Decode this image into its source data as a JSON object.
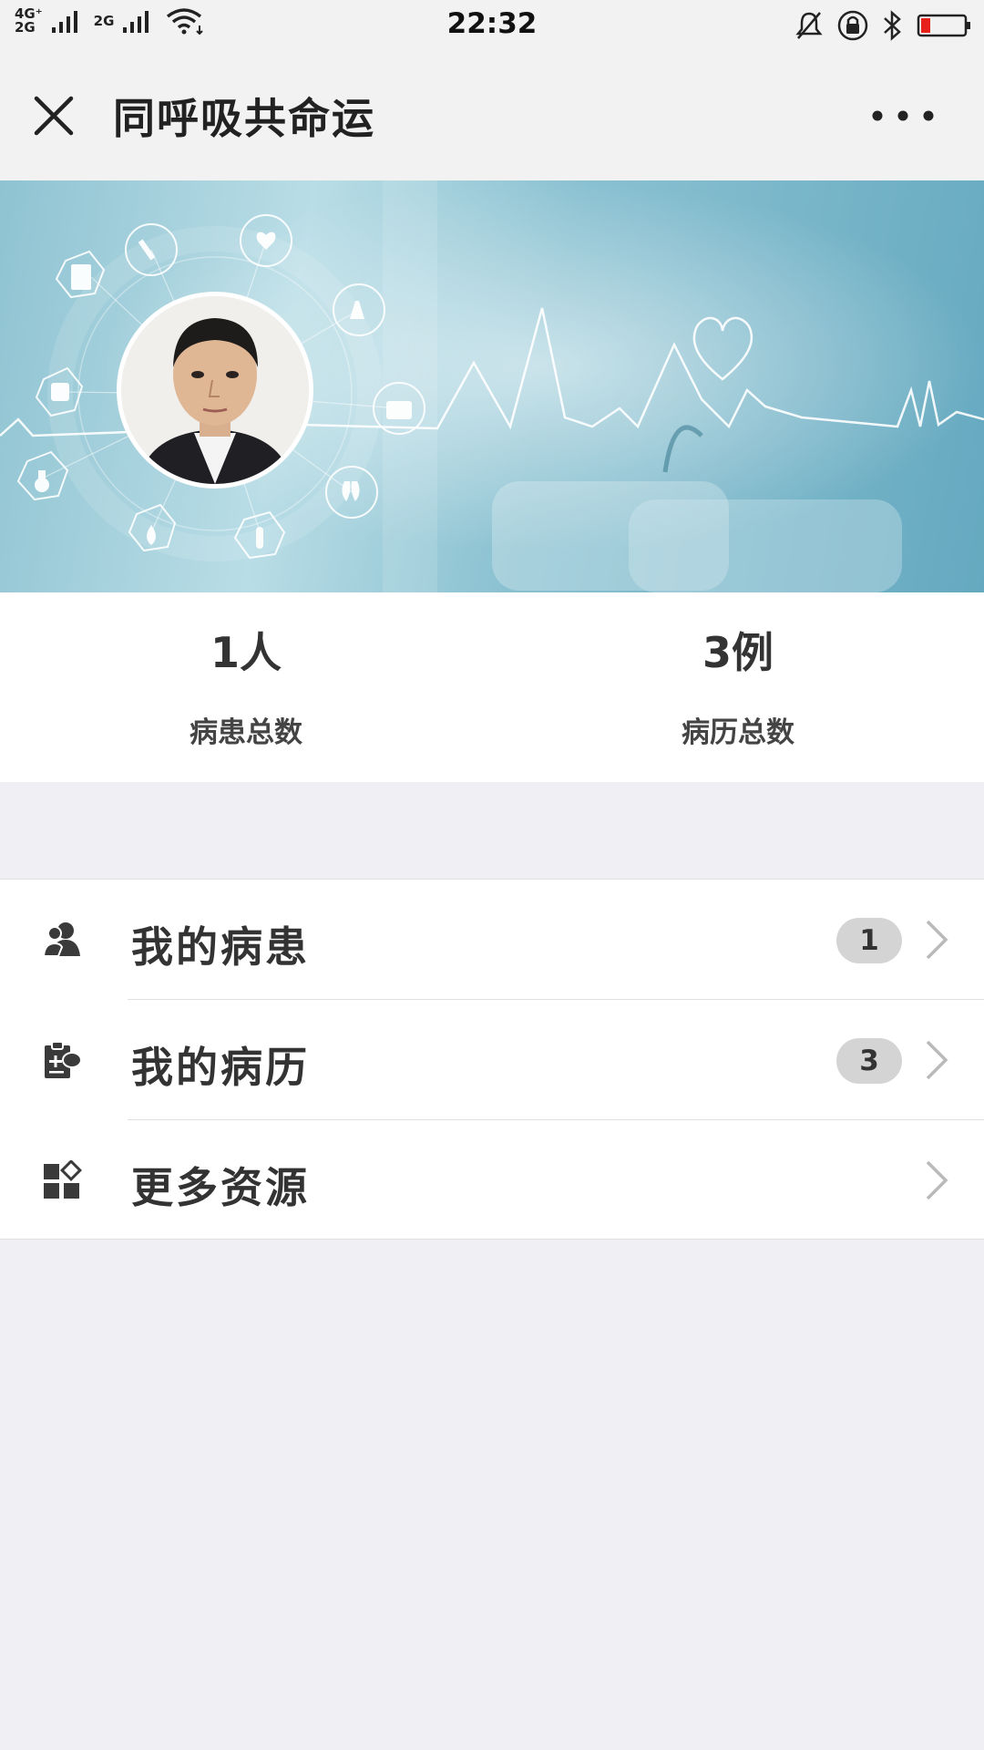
{
  "status_bar": {
    "network_left": "4G⁺\n2G",
    "network_right": "2G",
    "time": "22:32"
  },
  "nav": {
    "title": "同呼吸共命运",
    "close_icon": "close-icon",
    "more_icon": "more-icon"
  },
  "stats": [
    {
      "value": "1人",
      "label": "病患总数"
    },
    {
      "value": "3例",
      "label": "病历总数"
    }
  ],
  "menu": [
    {
      "label": "我的病患",
      "badge": "1",
      "icon": "patients-icon"
    },
    {
      "label": "我的病历",
      "badge": "3",
      "icon": "medical-record-icon"
    },
    {
      "label": "更多资源",
      "icon": "resources-icon"
    }
  ],
  "colors": {
    "banner_accent": "#65a9c0",
    "badge_bg": "#d4d4d4",
    "battery_low": "#e8201c"
  }
}
